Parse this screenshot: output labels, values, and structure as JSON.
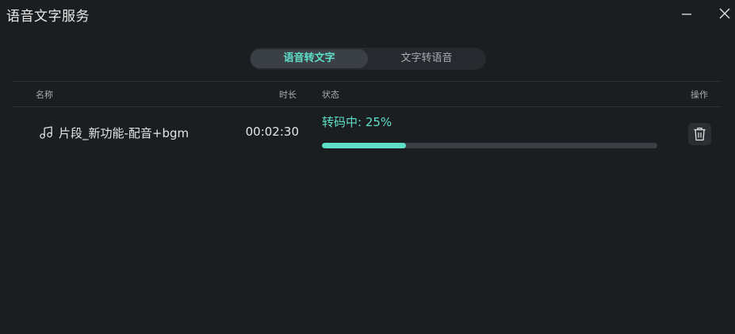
{
  "window": {
    "title": "语音文字服务",
    "minimize_icon": "minimize-icon",
    "close_icon": "close-icon"
  },
  "tabs": [
    {
      "label": "语音转文字",
      "active": true
    },
    {
      "label": "文字转语音",
      "active": false
    }
  ],
  "table": {
    "headers": {
      "name": "名称",
      "duration": "时长",
      "status": "状态",
      "actions": "操作"
    },
    "rows": [
      {
        "icon": "music-note-icon",
        "name": "片段_新功能-配音+bgm",
        "duration": "00:02:30",
        "status": "转码中:  25%",
        "progress": 0.25,
        "action_icon": "trash-icon"
      }
    ]
  },
  "colors": {
    "accent": "#5ee0c8",
    "background": "#1b1e21",
    "segment_bg": "#262a2e",
    "segment_active": "#3b4047",
    "track": "#3a3f45"
  }
}
